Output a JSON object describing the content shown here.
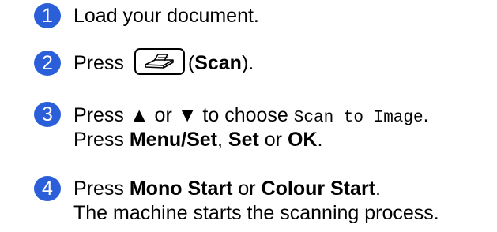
{
  "colors": {
    "step_badge": "#2B5FD9"
  },
  "steps": [
    {
      "number": "1",
      "text": "Load your document."
    },
    {
      "number": "2",
      "press": "Press",
      "key_icon": "scanner-key-icon",
      "open_paren": "(",
      "key_label": "Scan",
      "close_paren": ")."
    },
    {
      "number": "3",
      "line1_prefix": "Press ▲ or ▼ to choose",
      "line1_code": "Scan to Image",
      "line1_end": ".",
      "line2_prefix": "Press",
      "key1": "Menu/Set",
      "sep1": ",",
      "key2": "Set",
      "sep2": "or",
      "key3": "OK",
      "end": "."
    },
    {
      "number": "4",
      "line1_prefix": "Press",
      "key1": "Mono Start",
      "sep": "or",
      "key2": "Colour Start",
      "end": ".",
      "line2": "The machine starts the scanning process."
    }
  ]
}
